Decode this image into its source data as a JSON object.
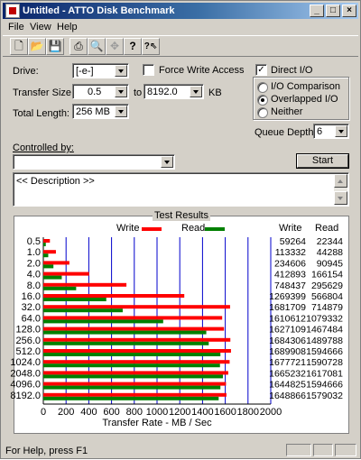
{
  "window": {
    "title": "Untitled - ATTO Disk Benchmark",
    "controls": {
      "minimize": "_",
      "maximize": "□",
      "close": "×"
    }
  },
  "menu": [
    "File",
    "View",
    "Help"
  ],
  "toolbar": [
    {
      "icon": "new-document-icon",
      "glyph": "🗋",
      "enabled": true
    },
    {
      "icon": "open-folder-icon",
      "glyph": "📂",
      "enabled": true
    },
    {
      "icon": "save-disk-icon",
      "glyph": "💾",
      "enabled": true
    },
    {
      "icon": "print-icon",
      "glyph": "⎙",
      "enabled": true
    },
    {
      "icon": "print-preview-icon",
      "glyph": "🔍",
      "enabled": true
    },
    {
      "icon": "move-icon",
      "glyph": "✥",
      "enabled": false
    },
    {
      "icon": "help-icon",
      "glyph": "?",
      "enabled": true
    },
    {
      "icon": "context-help-icon",
      "glyph": "?⇖",
      "enabled": true
    }
  ],
  "settings": {
    "drive_label": "Drive:",
    "drive_value": "[-e-]",
    "force_write_label": "Force Write Access",
    "force_write_checked": false,
    "direct_io_label": "Direct I/O",
    "direct_io_checked": true,
    "transfer_size_label": "Transfer Size:",
    "transfer_from": "0.5",
    "to_label": "to",
    "transfer_to": "8192.0",
    "kb_label": "KB",
    "total_length_label": "Total Length:",
    "total_length_value": "256 MB",
    "io_modes": [
      {
        "label": "I/O Comparison",
        "selected": false
      },
      {
        "label": "Overlapped I/O",
        "selected": true
      },
      {
        "label": "Neither",
        "selected": false
      }
    ],
    "queue_depth_label": "Queue Depth:",
    "queue_depth_value": "6",
    "controlled_by_label": "Controlled by:",
    "controlled_by_value": "",
    "start_label": "Start",
    "description_text": "<< Description >>"
  },
  "results": {
    "title": "Test Results",
    "legend_write": "Write",
    "legend_read": "Read",
    "col_write": "Write",
    "col_read": "Read",
    "colors": {
      "write": "#ff0000",
      "read": "#008000",
      "grid": "#0000cc"
    }
  },
  "chart_data": {
    "type": "bar",
    "orientation": "horizontal",
    "xlabel": "Transfer Rate - MB / Sec",
    "xlim": [
      0,
      2000
    ],
    "xticks": [
      0,
      200,
      400,
      600,
      800,
      1000,
      1200,
      1400,
      1600,
      1800,
      2000
    ],
    "categories": [
      "0.5",
      "1.0",
      "2.0",
      "4.0",
      "8.0",
      "16.0",
      "32.0",
      "64.0",
      "128.0",
      "256.0",
      "512.0",
      "1024.0",
      "2048.0",
      "4096.0",
      "8192.0"
    ],
    "series": [
      {
        "name": "Write",
        "color": "#ff0000",
        "values": [
          59264,
          113332,
          234606,
          412893,
          748437,
          1269399,
          1681709,
          1610612,
          1627109,
          1684306,
          1689908,
          1677721,
          1665232,
          1644825,
          1648866
        ]
      },
      {
        "name": "Read",
        "color": "#008000",
        "values": [
          22344,
          44288,
          90945,
          166154,
          295629,
          566804,
          714879,
          1079332,
          1467484,
          1489788,
          1594666,
          1590728,
          1617081,
          1594666,
          1579032
        ]
      }
    ],
    "bar_scale_note": "values shown in KB/s in table"
  },
  "status": {
    "text": "For Help, press F1"
  }
}
